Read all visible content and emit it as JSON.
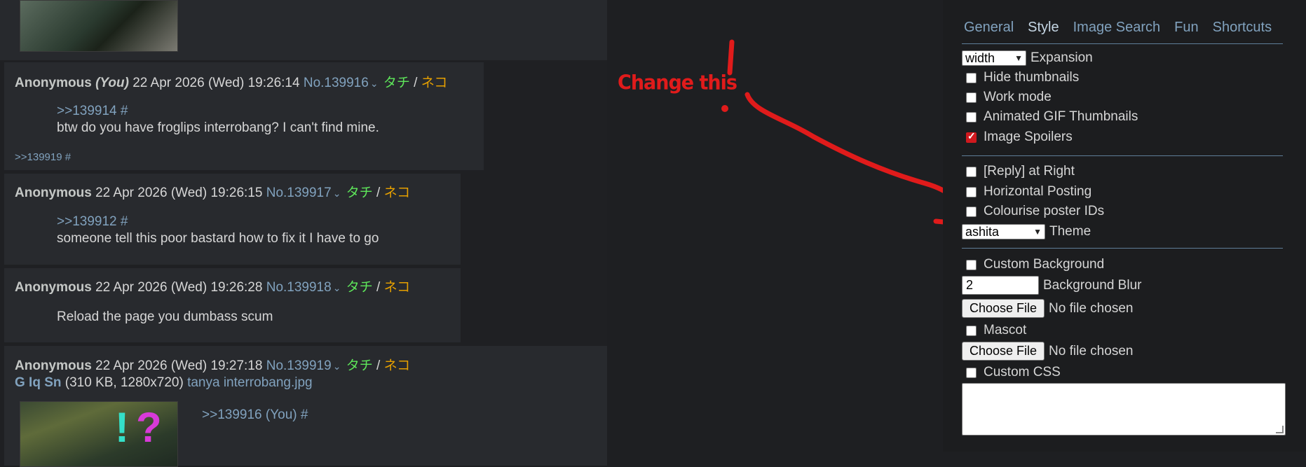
{
  "posts": [
    {
      "name": "Anonymous",
      "you": "(You)",
      "datetime": "22 Apr 2026 (Wed) 19:26:14",
      "number": "No.139916",
      "chevron": "⌄",
      "tachi": "タチ",
      "sep": "/",
      "neko": "ネコ",
      "quote": ">>139914 #",
      "message": "btw do you have froglips interrobang? I can't find mine.",
      "backlink": ">>139919 #"
    },
    {
      "name": "Anonymous",
      "datetime": "22 Apr 2026 (Wed) 19:26:15",
      "number": "No.139917",
      "chevron": "⌄",
      "tachi": "タチ",
      "sep": "/",
      "neko": "ネコ",
      "quote": ">>139912 #",
      "message": "someone tell this poor bastard how to fix it I have to go"
    },
    {
      "name": "Anonymous",
      "datetime": "22 Apr 2026 (Wed) 19:26:28",
      "number": "No.139918",
      "chevron": "⌄",
      "tachi": "タチ",
      "sep": "/",
      "neko": "ネコ",
      "message": "Reload the page you dumbass scum"
    },
    {
      "name": "Anonymous",
      "datetime": "22 Apr 2026 (Wed) 19:27:18",
      "number": "No.139919",
      "chevron": "⌄",
      "tachi": "タチ",
      "sep": "/",
      "neko": "ネコ",
      "file_links": "G Iq Sn",
      "file_info": "(310 KB, 1280x720)",
      "file_name": "tanya interrobang.jpg",
      "quote": ">>139916 (You) #"
    }
  ],
  "annotation": {
    "text": "Change this",
    "color": "#e01b1b"
  },
  "settings": {
    "tabs": [
      "General",
      "Style",
      "Image Search",
      "Fun",
      "Shortcuts"
    ],
    "active_tab": "Style",
    "expansion": {
      "select_value": "width",
      "label": "Expansion"
    },
    "checkboxes1": [
      {
        "label": "Hide thumbnails",
        "checked": false
      },
      {
        "label": "Work mode",
        "checked": false
      },
      {
        "label": "Animated GIF Thumbnails",
        "checked": false
      },
      {
        "label": "Image Spoilers",
        "checked": true
      }
    ],
    "checkboxes2": [
      {
        "label": "[Reply] at Right",
        "checked": false
      },
      {
        "label": "Horizontal Posting",
        "checked": false
      },
      {
        "label": "Colourise poster IDs",
        "checked": false
      }
    ],
    "theme": {
      "select_value": "ashita",
      "label": "Theme"
    },
    "custom_background": {
      "label": "Custom Background",
      "checked": false
    },
    "background_blur": {
      "value": "2",
      "label": "Background Blur"
    },
    "file_button": "Choose File",
    "no_file": "No file chosen",
    "mascot": {
      "label": "Mascot",
      "checked": false
    },
    "custom_css": {
      "label": "Custom CSS",
      "checked": false
    }
  },
  "colors": {
    "link": "#81a2be",
    "tachi": "#5ee65a",
    "neko": "#e6a000",
    "post_bg": "#282a2e",
    "page_bg": "#1e1f22"
  }
}
